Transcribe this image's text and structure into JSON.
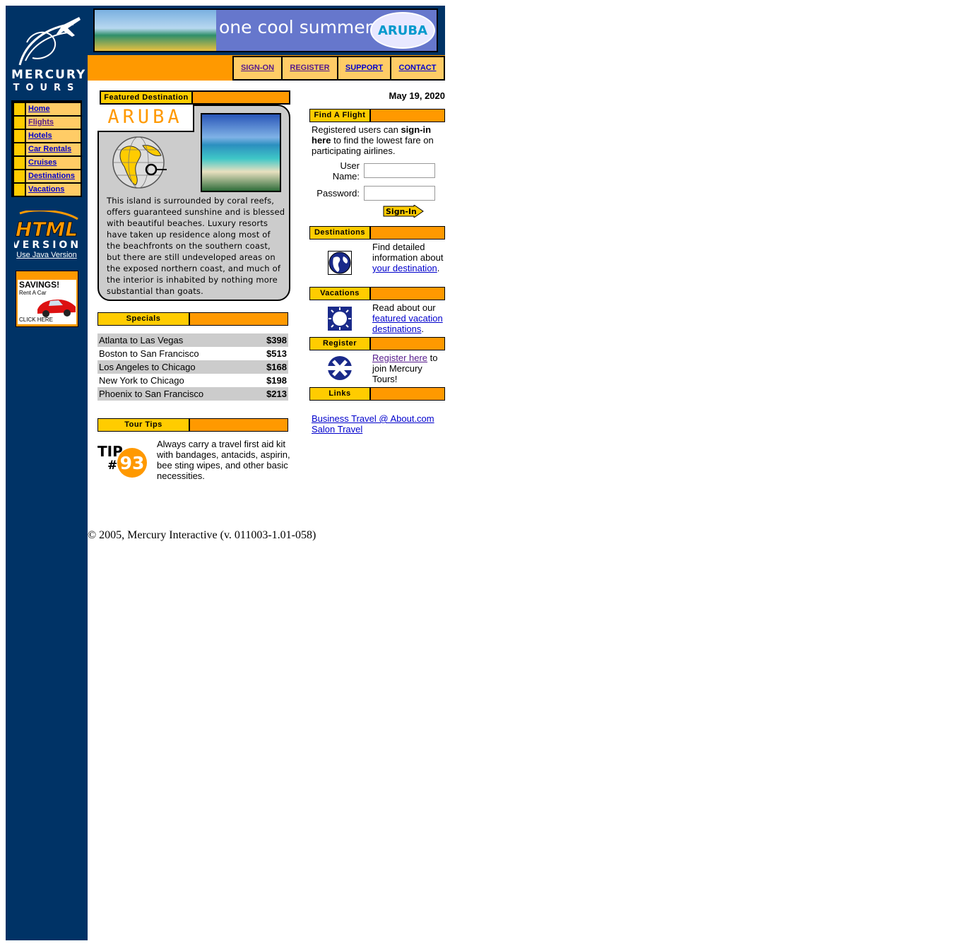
{
  "brand": {
    "name_line1": "MERCURY",
    "name_line2": "TOURS"
  },
  "banner": {
    "slogan": "one cool summer",
    "badge": "ARUBA"
  },
  "top_nav": {
    "items": [
      {
        "label": "SIGN-ON"
      },
      {
        "label": "REGISTER"
      },
      {
        "label": "SUPPORT"
      },
      {
        "label": "CONTACT"
      }
    ]
  },
  "side_nav": {
    "items": [
      {
        "label": "Home"
      },
      {
        "label": "Flights"
      },
      {
        "label": "Hotels"
      },
      {
        "label": "Car Rentals"
      },
      {
        "label": "Cruises"
      },
      {
        "label": "Destinations"
      },
      {
        "label": "Vacations"
      }
    ]
  },
  "html_version": {
    "line1": "HTML",
    "line2": "VERSION",
    "java_link": "Use Java Version"
  },
  "ad": {
    "headline": "SAVINGS!",
    "subline": "Rent A Car",
    "cta": "CLICK HERE"
  },
  "featured": {
    "header": "Featured Destination",
    "name": "ARUBA",
    "description": "This island is surrounded by coral reefs, offers guaranteed sunshine and is blessed with beautiful beaches. Luxury resorts have taken up residence along most of the beachfronts on the southern coast, but there are still undeveloped areas on the exposed northern coast, and much of the interior is inhabited by nothing more substantial than goats."
  },
  "specials": {
    "header": "Specials",
    "rows": [
      {
        "route": "Atlanta to Las Vegas",
        "price": "$398"
      },
      {
        "route": "Boston to San Francisco",
        "price": "$513"
      },
      {
        "route": "Los Angeles to Chicago",
        "price": "$168"
      },
      {
        "route": "New York to Chicago",
        "price": "$198"
      },
      {
        "route": "Phoenix to San Francisco",
        "price": "$213"
      }
    ]
  },
  "tour_tips": {
    "header": "Tour Tips",
    "tip_word": "TIP",
    "tip_hash": "#",
    "tip_number": "93",
    "text": "Always carry a travel first aid kit with bandages, antacids, aspirin, bee sting wipes, and other basic necessities."
  },
  "date": "May 19, 2020",
  "find_flight": {
    "header": "Find A Flight",
    "intro_pre": "Registered users can ",
    "intro_bold": "sign-in here",
    "intro_post": " to find the lowest fare on participating airlines.",
    "username_label": "User Name:",
    "username_value": "",
    "password_label": "Password:",
    "password_value": "",
    "signin_button": "Sign-In"
  },
  "destinations": {
    "header": "Destinations",
    "text_pre": "Find detailed information about ",
    "link": "your destination",
    "text_post": "."
  },
  "vacations": {
    "header": "Vacations",
    "text_pre": "Read about our ",
    "link": "featured vacation destinations",
    "text_post": "."
  },
  "register": {
    "header": "Register",
    "link": "Register here",
    "text_post": " to join Mercury Tours!"
  },
  "links": {
    "header": "Links",
    "items": [
      {
        "label": "Business Travel @ About.com"
      },
      {
        "label": "Salon Travel"
      }
    ]
  },
  "footer": {
    "copyright": "© 2005, Mercury Interactive (v. 011003-1.01-058)"
  },
  "colors": {
    "sidebar": "#003366",
    "orange": "#ff9900",
    "yellow": "#ffcc00",
    "light_orange": "#ffcc66",
    "grey": "#cccccc"
  }
}
